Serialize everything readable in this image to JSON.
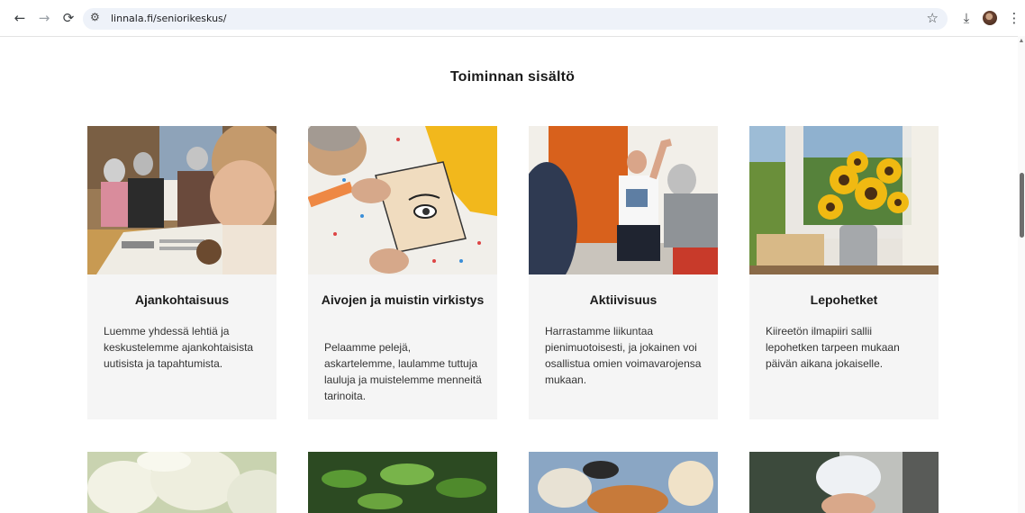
{
  "browser": {
    "url": "linnala.fi/seniorikeskus/",
    "back_icon": "←",
    "forward_icon": "→",
    "reload_icon": "⟳",
    "site_info_icon": "⚙",
    "bookmark_icon": "☆",
    "download_icon": "⤓",
    "menu_icon": "⋮"
  },
  "section": {
    "title": "Toiminnan sisältö"
  },
  "cards": [
    {
      "title": "Ajankohtaisuus",
      "text": "Luemme yhdessä lehtiä ja keskustelemme ajankohtaisista uutisista ja tapahtumista."
    },
    {
      "title": "Aivojen ja muistin virkistys",
      "text": "Pelaamme pelejä, askartelemme, laulamme tuttuja lauluja ja muistelemme menneitä tarinoita."
    },
    {
      "title": "Aktiivisuus",
      "text": "Harrastamme liikuntaa pienimuotoisesti, ja jokainen voi osallistua omien voimavarojensa mukaan."
    },
    {
      "title": "Lepohetket",
      "text": "Kiireetön ilmapiiri sallii lepohetken tarpeen mukaan päivän aikana jokaiselle."
    }
  ]
}
